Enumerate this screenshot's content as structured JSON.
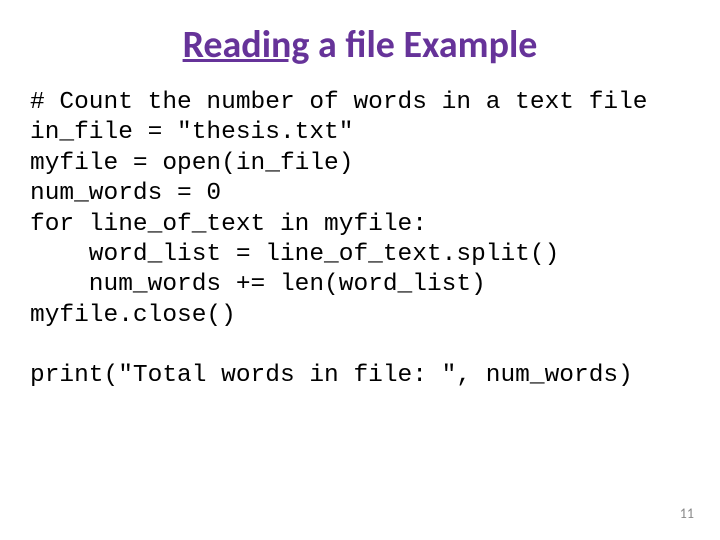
{
  "title": {
    "underlined": "Reading",
    "rest": " a file Example"
  },
  "code": {
    "l1": "# Count the number of words in a text file",
    "l2": "in_file = \"thesis.txt\"",
    "l3": "myfile = open(in_file)",
    "l4": "num_words = 0",
    "l5": "for line_of_text in myfile:",
    "l6": "    word_list = line_of_text.split()",
    "l7": "    num_words += len(word_list)",
    "l8": "myfile.close()",
    "l9": "",
    "l10": "print(\"Total words in file: \", num_words)"
  },
  "page_number": "11"
}
